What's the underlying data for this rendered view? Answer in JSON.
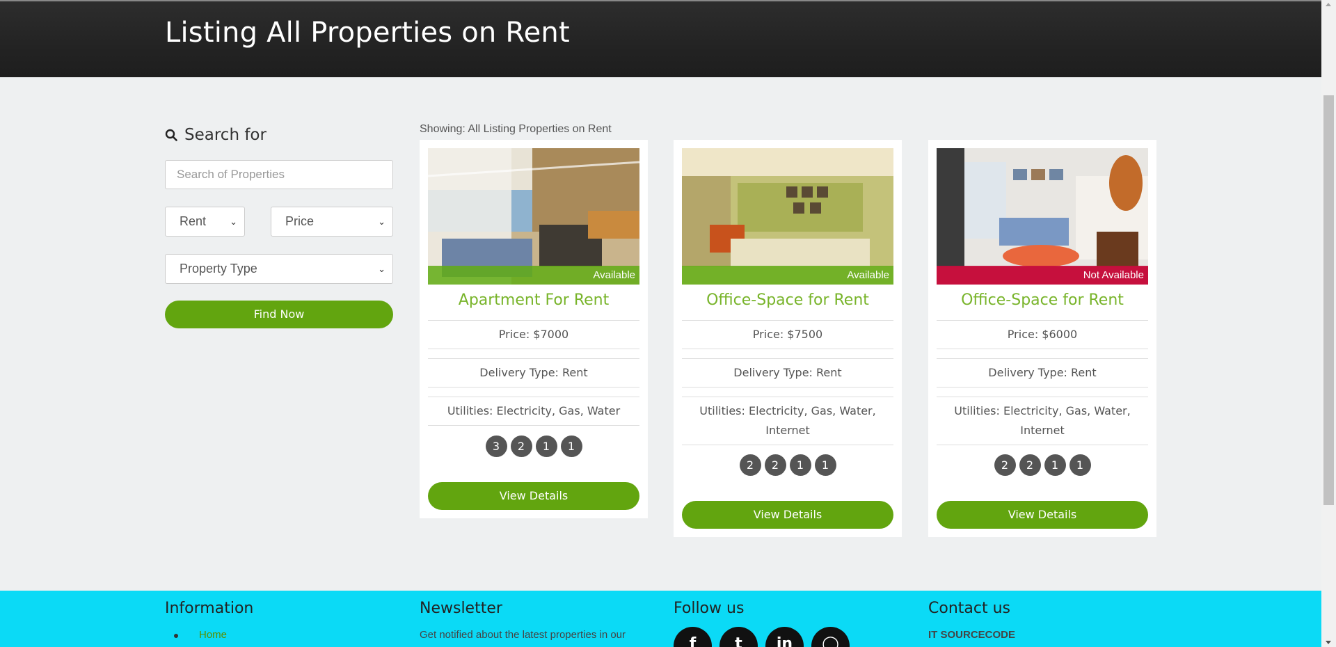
{
  "header": {
    "title": "Listing All Properties on Rent"
  },
  "search": {
    "title": "Search for",
    "placeholder": "Search of Properties",
    "delivery_select": "Rent",
    "price_select": "Price",
    "type_select": "Property Type",
    "find_button": "Find Now"
  },
  "listing": {
    "showing": "Showing: All Listing Properties on Rent",
    "cards": [
      {
        "title": "Apartment For Rent",
        "status": "Available",
        "price": "Price: $7000",
        "delivery": "Delivery Type: Rent",
        "utilities": "Utilities: Electricity, Gas, Water",
        "utilities_line2": "",
        "counts": [
          "3",
          "2",
          "1",
          "1"
        ],
        "button": "View Details"
      },
      {
        "title": "Office-Space for Rent",
        "status": "Available",
        "price": "Price: $7500",
        "delivery": "Delivery Type: Rent",
        "utilities": "Utilities: Electricity, Gas, Water,",
        "utilities_line2": "Internet",
        "counts": [
          "2",
          "2",
          "1",
          "1"
        ],
        "button": "View Details"
      },
      {
        "title": "Office-Space for Rent",
        "status": "Not Available",
        "price": "Price: $6000",
        "delivery": "Delivery Type: Rent",
        "utilities": "Utilities: Electricity, Gas, Water,",
        "utilities_line2": "Internet",
        "counts": [
          "2",
          "2",
          "1",
          "1"
        ],
        "button": "View Details"
      }
    ]
  },
  "footer": {
    "information_heading": "Information",
    "home_link": "Home",
    "newsletter_heading": "Newsletter",
    "newsletter_text": "Get notified about the latest properties in our",
    "follow_heading": "Follow us",
    "social_icons": [
      "facebook-icon",
      "twitter-icon",
      "linkedin-icon",
      "instagram-icon"
    ],
    "contact_heading": "Contact us",
    "company": "IT SOURCECODE"
  },
  "colors": {
    "brand_green": "#62a50f",
    "title_green": "#78b42a",
    "footer_cyan": "#0bdaf6",
    "not_available": "#c80a3c",
    "header_dark": "#252525"
  }
}
